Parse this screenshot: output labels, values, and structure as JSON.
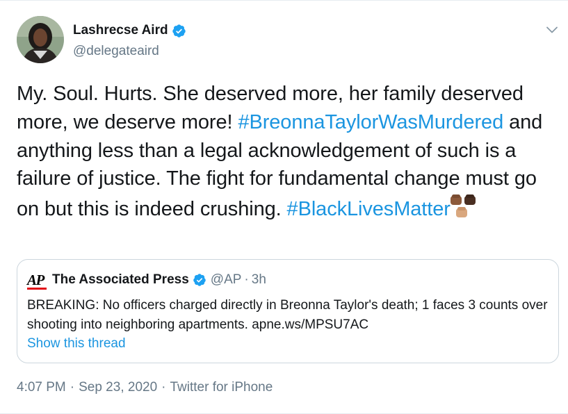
{
  "tweet": {
    "author": {
      "name": "Lashrecse Aird",
      "handle": "@delegateaird",
      "verified": true
    },
    "text": {
      "part1": "My. Soul. Hurts. She deserved more, her family deserved more, we deserve more! ",
      "hashtag1": "#BreonnaTaylorWasMurdered",
      "part2": " and anything less than a legal acknowledgement of such is a failure of justice. The fight for fundamental change must go on but this is indeed crushing. ",
      "hashtag2": "#BlackLivesMatter"
    },
    "emoji": "raised-fists-emoji",
    "quoted": {
      "logo_text": "AP",
      "name": "The Associated Press",
      "handle": "@AP",
      "dot": "·",
      "time": "3h",
      "body": "BREAKING: No officers charged directly in Breonna Taylor's death; 1 faces 3 counts over shooting into neighboring apartments. apne.ws/MPSU7AC",
      "show_thread": "Show this thread"
    },
    "footer": {
      "time": "4:07 PM",
      "sep1": "·",
      "date": "Sep 23, 2020",
      "sep2": "·",
      "source": "Twitter for iPhone"
    }
  },
  "icons": {
    "verified": "verified-badge-icon",
    "more": "chevron-down-icon"
  },
  "colors": {
    "link": "#1b95e0",
    "verified": "#1da1f2",
    "secondary_text": "#657786",
    "border": "#ccd6dd",
    "ap_red": "#e20a17"
  }
}
